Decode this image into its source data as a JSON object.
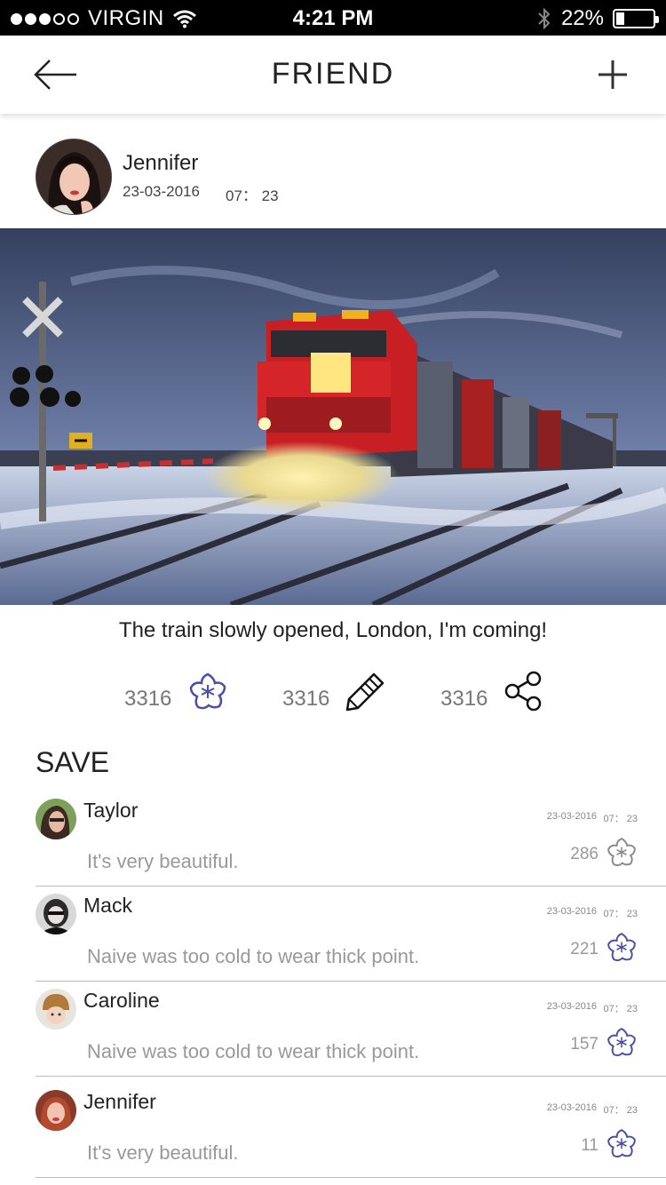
{
  "status_bar": {
    "carrier": "VIRGIN",
    "signal_dots_filled": 3,
    "signal_dots_total": 5,
    "time": "4:21 PM",
    "battery_text": "22%",
    "battery_level": 0.22
  },
  "nav": {
    "title": "FRIEND",
    "back_icon": "arrow-left-icon",
    "add_icon": "plus-icon"
  },
  "post": {
    "author_name": "Jennifer",
    "date": "23-03-2016",
    "time": "07： 23",
    "caption": "The train slowly opened, London, I'm coming!",
    "actions": [
      {
        "count": "3316",
        "icon": "star-flower-icon"
      },
      {
        "count": "3316",
        "icon": "pencil-icon"
      },
      {
        "count": "3316",
        "icon": "share-icon"
      }
    ]
  },
  "section_title": "SAVE",
  "comments": [
    {
      "name": "Taylor",
      "text": "It's very beautiful.",
      "date": "23-03-2016",
      "time": "07： 23",
      "count": "286",
      "starred": false
    },
    {
      "name": "Mack",
      "text": "Naive was too cold to wear thick point.",
      "date": "23-03-2016",
      "time": "07： 23",
      "count": "221",
      "starred": true
    },
    {
      "name": "Caroline",
      "text": "Naive was too cold to wear thick point.",
      "date": "23-03-2016",
      "time": "07： 23",
      "count": "157",
      "starred": true
    },
    {
      "name": "Jennifer",
      "text": "It's very beautiful.",
      "date": "23-03-2016",
      "time": "07： 23",
      "count": "11",
      "starred": true
    }
  ],
  "colors": {
    "accent_star": "#4a4fa8",
    "inactive_star": "#8a8a8a",
    "muted_text": "#999999"
  }
}
